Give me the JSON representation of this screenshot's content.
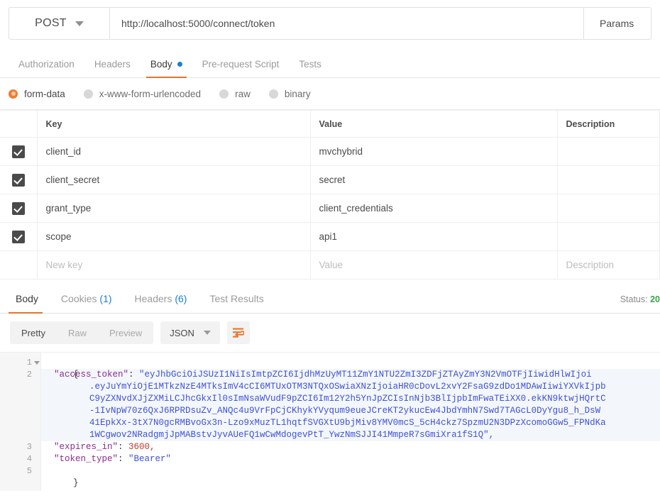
{
  "request": {
    "method": "POST",
    "url": "http://localhost:5000/connect/token",
    "params_label": "Params",
    "tabs": [
      {
        "label": "Authorization",
        "active": false,
        "dot": false
      },
      {
        "label": "Headers",
        "active": false,
        "dot": false
      },
      {
        "label": "Body",
        "active": true,
        "dot": true
      },
      {
        "label": "Pre-request Script",
        "active": false,
        "dot": false
      },
      {
        "label": "Tests",
        "active": false,
        "dot": false
      }
    ],
    "body_types": [
      {
        "label": "form-data",
        "selected": true
      },
      {
        "label": "x-www-form-urlencoded",
        "selected": false
      },
      {
        "label": "raw",
        "selected": false
      },
      {
        "label": "binary",
        "selected": false
      }
    ],
    "table": {
      "headers": {
        "key": "Key",
        "value": "Value",
        "description": "Description"
      },
      "rows": [
        {
          "checked": true,
          "key": "client_id",
          "value": "mvchybrid",
          "description": ""
        },
        {
          "checked": true,
          "key": "client_secret",
          "value": "secret",
          "description": ""
        },
        {
          "checked": true,
          "key": "grant_type",
          "value": "client_credentials",
          "description": ""
        },
        {
          "checked": true,
          "key": "scope",
          "value": "api1",
          "description": ""
        }
      ],
      "new_row": {
        "key_placeholder": "New key",
        "value_placeholder": "Value",
        "description_placeholder": "Description"
      }
    }
  },
  "response": {
    "tabs": [
      {
        "label": "Body",
        "count": "",
        "active": true
      },
      {
        "label": "Cookies",
        "count": "(1)",
        "active": false
      },
      {
        "label": "Headers",
        "count": "(6)",
        "active": false
      },
      {
        "label": "Test Results",
        "count": "",
        "active": false
      }
    ],
    "status_label": "Status:",
    "status_code": "20",
    "format_modes": [
      {
        "label": "Pretty",
        "active": true
      },
      {
        "label": "Raw",
        "active": false
      },
      {
        "label": "Preview",
        "active": false
      }
    ],
    "language": "JSON",
    "wrap_icon": "word-wrap-icon",
    "code": {
      "line_numbers": [
        "1",
        "2",
        "3",
        "4",
        "5"
      ],
      "fold_lines": [
        "1",
        "2"
      ],
      "access_token_key": "\"access_token\"",
      "access_token_parts": [
        "\"eyJhbGciOiJSUzI1NiIsImtpZCI6IjdhMzUyMT11ZmY1NTU2ZmI3ZDFjZTAyZmY3N2VmOTFjIiwidHlwIjoi",
        ".eyJuYmYiOjE1MTkzNzE4MTksImV4cCI6MTUxOTM3NTQxOSwiaXNzIjoiaHR0cDovL2xvY2FsaG9zdDo1MDAwIiwiYXVkIjpb",
        "C9yZXNvdXJjZXMiLCJhcGkxIl0sImNsaWVudF9pZCI6Im12Y2h5YnJpZCIsInNjb3BlIjpbImFwaTEiXX0.ekKN9ktwjHQrtC",
        "-1IvNpW70z6QxJ6RPRDsuZv_ANQc4u9VrFpCjCKhykYVyqum9eueJCreKT2ykucEw4JbdYmhN7Swd7TAGcL0DyYgu8_h_DsW",
        "41EpkXx-3tX7N0gcRMBvoGx3n-Lzo9xMuzTL1hqtfSVGXtU9bjMiv8YMV0mcS_5cH4ckz7SpzmU2N3DPzXcomoGGw5_FPNdKa",
        "1WCgwov2NRadgmjJpMABstvJyvAUeFQ1wCwMdogevPtT_YwzNmSJJI41MmpeR7sGmiXra1fS1Q\","
      ],
      "expires_in_key": "\"expires_in\"",
      "expires_in_value": "3600,",
      "token_type_key": "\"token_type\"",
      "token_type_value": "\"Bearer\"",
      "open_brace": "{",
      "close_brace": "}",
      "colon": ": "
    }
  },
  "colors": {
    "accent": "#e8742c",
    "link": "#1a7fd4",
    "status_ok": "#3aa14a",
    "string": "#3f51d4",
    "key": "#8d2a8d",
    "number": "#c0392b"
  }
}
